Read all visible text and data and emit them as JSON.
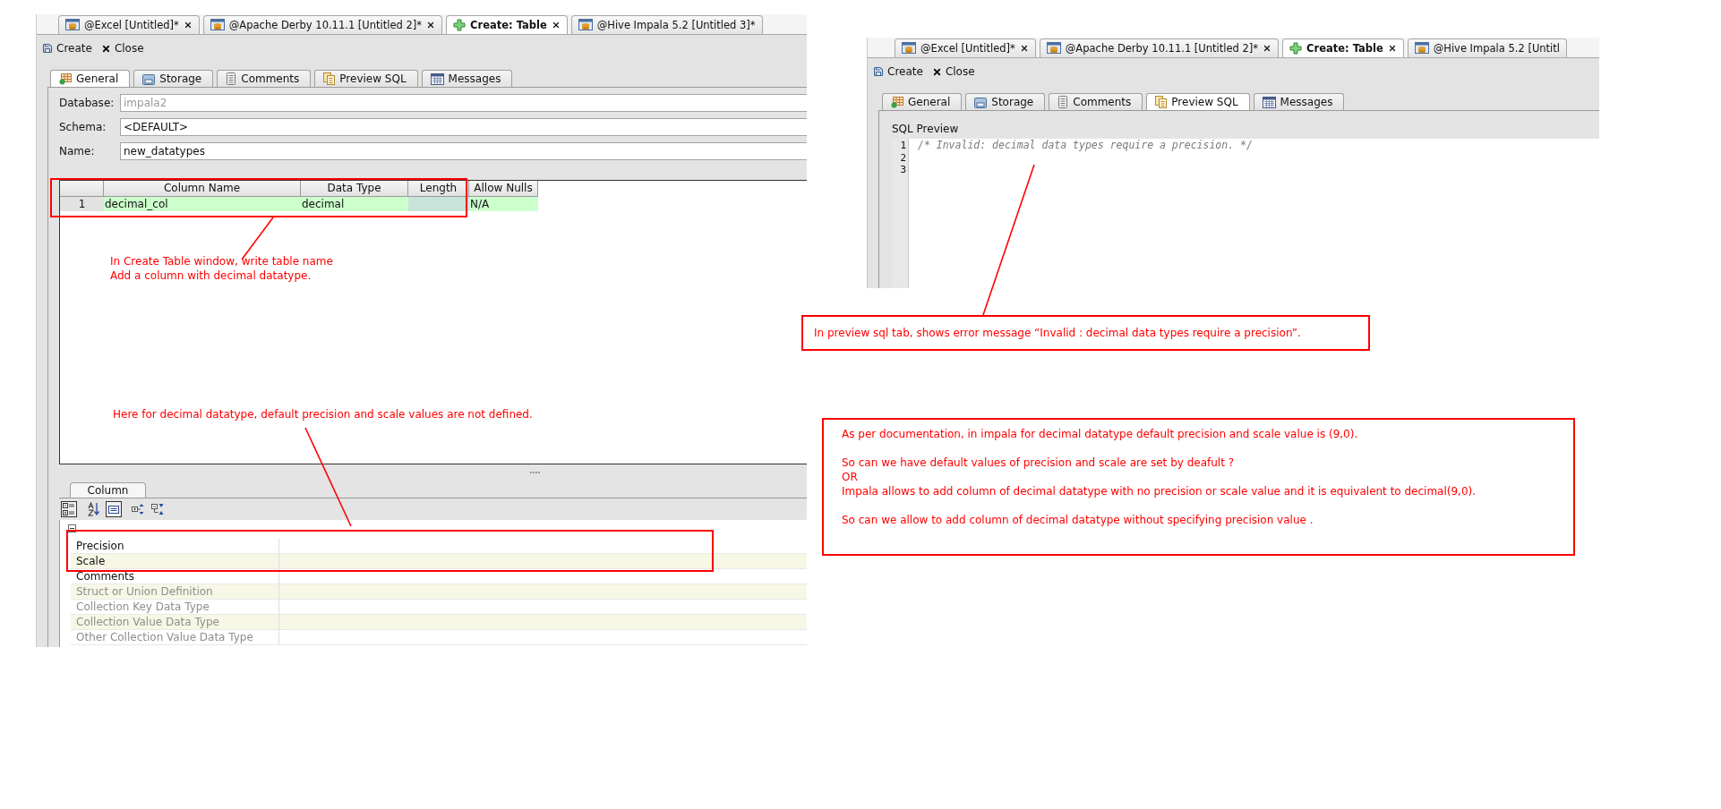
{
  "windows": [
    {
      "kind": "general",
      "tabs": [
        {
          "label": "@Excel [Untitled]*",
          "selected": false,
          "closable": true
        },
        {
          "label": "@Apache Derby 10.11.1  [Untitled 2]*",
          "selected": false,
          "closable": true
        },
        {
          "label": "Create: Table",
          "selected": true,
          "closable": true
        },
        {
          "label": "@Hive Impala 5.2 [Untitled 3]*",
          "selected": false,
          "closable": false
        }
      ],
      "toolbar": [
        "Create",
        "Close"
      ],
      "editor_tabs": [
        {
          "label": "General",
          "selected": true
        },
        {
          "label": "Storage",
          "selected": false
        },
        {
          "label": "Comments",
          "selected": false
        },
        {
          "label": "Preview SQL",
          "selected": false
        },
        {
          "label": "Messages",
          "selected": false
        }
      ],
      "fields": [
        {
          "label": "Database:",
          "value": "impala2",
          "disabled": true
        },
        {
          "label": "Schema:",
          "value": "<DEFAULT>",
          "disabled": false
        },
        {
          "label": "Name:",
          "value": "new_datatypes",
          "disabled": false
        }
      ],
      "grid": {
        "columns": [
          "Column Name",
          "Data Type",
          "Length",
          "Allow Nulls"
        ],
        "rows": [
          {
            "number": "1",
            "column_name": "decimal_col",
            "data_type": "decimal",
            "allow_nulls": "N/A"
          }
        ]
      },
      "panel_tab": "Column",
      "property_toolbar": [
        {
          "pressed": true
        },
        {
          "pressed": false
        },
        {
          "pressed": true
        },
        {
          "pressed": false
        },
        {
          "pressed": false
        }
      ],
      "properties": [
        {
          "label": "Precision",
          "enabled": true
        },
        {
          "label": "Scale",
          "enabled": true
        },
        {
          "label": "Comments",
          "enabled": true
        },
        {
          "label": "Struct or Union Definition",
          "enabled": false
        },
        {
          "label": "Collection Key Data Type",
          "enabled": false
        },
        {
          "label": "Collection Value Data Type",
          "enabled": false
        },
        {
          "label": "Other Collection Value Data Type",
          "enabled": false
        }
      ]
    },
    {
      "kind": "preview_sql",
      "tabs": [
        {
          "label": "@Excel [Untitled]*",
          "selected": false,
          "closable": true
        },
        {
          "label": "@Apache Derby 10.11.1  [Untitled 2]*",
          "selected": false,
          "closable": true
        },
        {
          "label": "Create: Table",
          "selected": true,
          "closable": true
        },
        {
          "label": "@Hive Impala 5.2 [Untitl",
          "selected": false,
          "closable": false
        }
      ],
      "toolbar": [
        "Create",
        "Close"
      ],
      "editor_tabs": [
        {
          "label": "General",
          "selected": false
        },
        {
          "label": "Storage",
          "selected": false
        },
        {
          "label": "Comments",
          "selected": false
        },
        {
          "label": "Preview SQL",
          "selected": true
        },
        {
          "label": "Messages",
          "selected": false
        }
      ],
      "section_label": "SQL Preview",
      "line_numbers": [
        "1",
        "2",
        "3"
      ],
      "code": "/* Invalid: decimal data types require a precision. */"
    }
  ],
  "annotations": [
    {
      "kind": "frame"
    },
    {
      "kind": "note",
      "lines": [
        "In Create Table window, write table name",
        "Add a column with decimal datatype."
      ]
    },
    {
      "kind": "note",
      "lines": [
        "Here for decimal datatype, default precision and scale values are not defined."
      ]
    },
    {
      "kind": "frame"
    },
    {
      "kind": "callout",
      "paragraphs": [
        [
          "In preview sql tab, shows error message “Invalid : decimal data types require a precision”."
        ]
      ]
    },
    {
      "kind": "callout",
      "paragraphs": [
        [
          "As per documentation, in impala for decimal datatype default precision and scale value is (9,0)."
        ],
        [
          "So can we have default values of precision and scale are set by deafult ?",
          "OR",
          "Impala allows to add column of decimal datatype with no precision or scale value and it is equivalent to decimal(9,0)."
        ],
        [
          "So can we allow to add column of decimal datatype without specifying precision value ."
        ]
      ]
    }
  ]
}
